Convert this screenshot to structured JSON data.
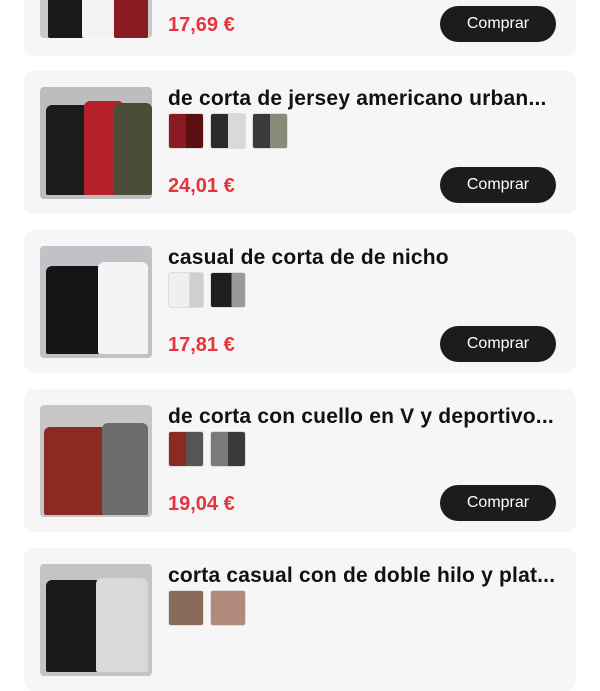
{
  "products": [
    {
      "title": "",
      "price": "17,69 €",
      "buy_label": "Comprar",
      "thumb_colors": [
        "#1a1a1a",
        "#f2f2f2",
        "#8b1a22"
      ],
      "variant_count": 0
    },
    {
      "title": "de corta de jersey americano urban...",
      "price": "24,01 €",
      "buy_label": "Comprar",
      "thumb_colors": [
        "#1b1b1b",
        "#b5202a",
        "#4a4d37"
      ],
      "variant_count": 3
    },
    {
      "title": "casual de corta de de nicho",
      "price": "17,81 €",
      "buy_label": "Comprar",
      "thumb_colors": [
        "#151515",
        "#f4f4f4"
      ],
      "variant_count": 2
    },
    {
      "title": "de corta con cuello en V y deportivo...",
      "price": "19,04 €",
      "buy_label": "Comprar",
      "thumb_colors": [
        "#8a2a22",
        "#6c6c6c"
      ],
      "variant_count": 2
    },
    {
      "title": "corta casual con de doble hilo y plat...",
      "price": "",
      "buy_label": "",
      "thumb_colors": [
        "#1a1a1a",
        "#d9d9d9"
      ],
      "variant_count": 0
    }
  ],
  "colors": {
    "price": "#e5343d",
    "button": "#1c1c1c",
    "card": "#f6f6f6"
  }
}
